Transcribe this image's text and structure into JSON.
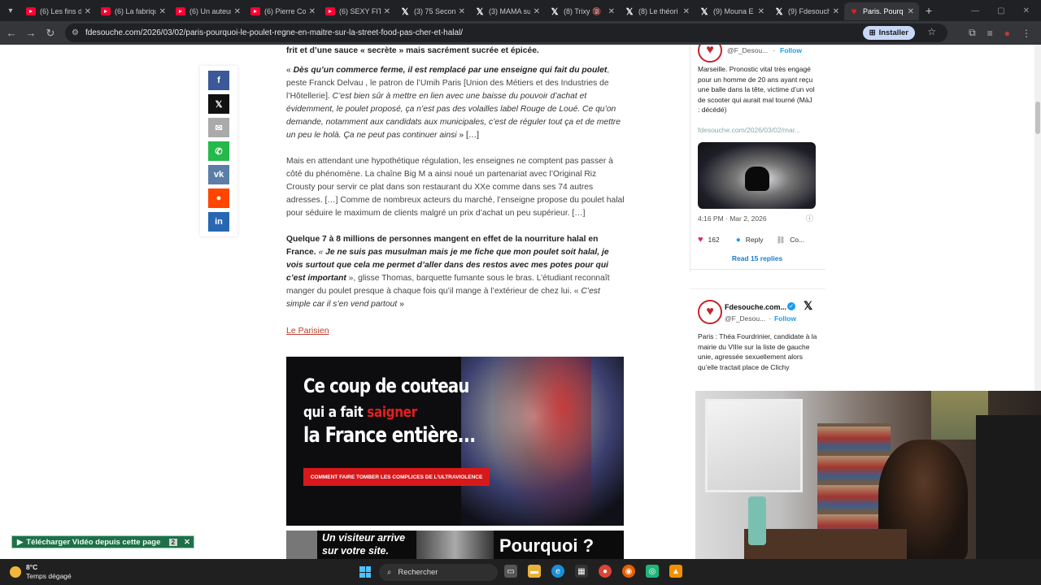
{
  "tabs": [
    {
      "label": "(6) Les fins d",
      "kind": "yt"
    },
    {
      "label": "(6) La fabriqu",
      "kind": "yt"
    },
    {
      "label": "(6) Un auteur",
      "kind": "yt"
    },
    {
      "label": "(6) Pierre Co",
      "kind": "yt"
    },
    {
      "label": "(6) SEXY FIT",
      "kind": "yt"
    },
    {
      "label": "(3) 75 Secon",
      "kind": "x"
    },
    {
      "label": "(3) MAMA sur",
      "kind": "x"
    },
    {
      "label": "(8) Trixy 🔞",
      "kind": "x"
    },
    {
      "label": "(8) Le théori",
      "kind": "x"
    },
    {
      "label": "(9) Mouna E",
      "kind": "x"
    },
    {
      "label": "(9) Fdesouch",
      "kind": "x"
    },
    {
      "label": "Paris. Pourq",
      "kind": "fd"
    }
  ],
  "address": {
    "url": "fdesouche.com/2026/03/02/paris-pourquoi-le-poulet-regne-en-maitre-sur-la-street-food-pas-cher-et-halal/",
    "install_label": "Installer"
  },
  "article": {
    "p0": "frit et d’une sauce « secrète » mais sacrément sucrée et épicée.",
    "p1_open": "« ",
    "p1_bold": "Dès qu’un commerce ferme, il est remplacé par une enseigne qui fait du poulet",
    "p1_rest": ", peste Franck Delvau , le patron de l’Umih Paris [Union des Métiers et des Industries de l’Hôtellerie]. ",
    "p1_italic": "C’est bien sûr à mettre en lien avec une baisse du pouvoir d’achat et évidemment, le poulet proposé, ça n’est pas des volailles label Rouge de Loué. Ce qu’on demande, notamment aux candidats aux municipales, c’est de réguler tout ça et de mettre un peu le holà. Ça ne peut pas continuer ainsi",
    "p1_end": " » […]",
    "p2": "Mais en attendant une hypothétique régulation, les enseignes ne comptent pas passer à côté du phénomène. La chaîne Big M a ainsi noué un partenariat avec l’Original Riz Crousty pour servir ce plat dans son restaurant du XXe comme dans ses 74 autres adresses. […] Comme de nombreux acteurs du marché, l’enseigne propose du poulet halal pour séduire le maximum de clients malgré un prix d’achat un peu supérieur. […]",
    "p3_bold": "Quelque 7 à 8 millions de personnes mangent en effet de la nourriture halal en France.",
    "p3_quote_open": " « ",
    "p3_bolditalic": "Je ne suis pas musulman mais je me fiche que mon poulet soit halal, je vois surtout que cela me permet d’aller dans des restos avec mes potes pour qui c’est important",
    "p3_mid": " », glisse Thomas, barquette fumante sous le bras. L’étudiant reconnaît manger du poulet presque à chaque fois qu’il mange à l’extérieur de chez lui. « ",
    "p3_italic": "C’est simple car il s’en vend partout",
    "p3_end": " »",
    "source": "Le Parisien"
  },
  "banner1": {
    "line1": "Ce coup de couteau",
    "line2a": "qui a fait ",
    "line2b": "saigner",
    "line3": "la France entière...",
    "cta": "COMMENT FAIRE TOMBER LES COMPLICES DE L’ULTRAVIOLENCE"
  },
  "banner2": {
    "line1": "Un visiteur arrive",
    "line2": "sur votre site.",
    "right": "Pourquoi ?"
  },
  "tweet1": {
    "handle": "@F_Desou...",
    "follow": "Follow",
    "text": "Marseille. Pronostic vital très engagé pour un homme de 20 ans ayant reçu une balle dans la tête, victime d’un vol de scooter qui aurait mal tourné (MàJ : décédé)",
    "link": "fdesouche.com/2026/03/02/mar...",
    "time": "4:16 PM · Mar 2, 2026",
    "likes": "162",
    "reply": "Reply",
    "copy": "Co...",
    "read_replies": "Read 15 replies"
  },
  "tweet2": {
    "name": "Fdesouche.com...",
    "handle": "@F_Desou...",
    "follow": "Follow",
    "text": "Paris : Théa Fourdrinier, candidate à la mairie du VIIIe sur la liste de gauche unie, agressée sexuellement alors qu’elle tractait place de Clichy"
  },
  "download_badge": {
    "label": "Télécharger Vidéo depuis cette page",
    "count": "2"
  },
  "taskbar": {
    "temp": "8°C",
    "weather": "Temps dégagé",
    "search": "Rechercher"
  }
}
